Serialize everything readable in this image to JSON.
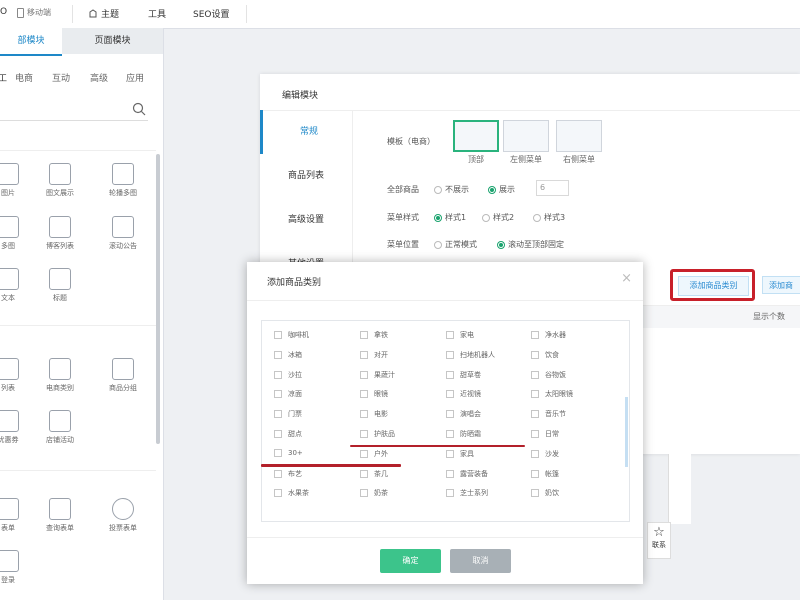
{
  "topbar": {
    "device": "移动端",
    "theme": "主题",
    "tools": "工具",
    "seo": "SEO设置"
  },
  "sidebar": {
    "tabs": [
      "部模块",
      "页面模块"
    ],
    "categories": [
      "电商",
      "互动",
      "高级",
      "应用"
    ],
    "components": [
      {
        "label": "图片",
        "icon": "image-icon"
      },
      {
        "label": "图文展示",
        "icon": "image-text-icon"
      },
      {
        "label": "轮播多图",
        "icon": "carousel-icon"
      },
      {
        "label": "多图",
        "icon": "multi-image-icon"
      },
      {
        "label": "博客列表",
        "icon": "blog-list-icon"
      },
      {
        "label": "滚动公告",
        "icon": "notice-icon"
      },
      {
        "label": "文本",
        "icon": "text-icon"
      },
      {
        "label": "标题",
        "icon": "title-icon"
      },
      {
        "label": "列表",
        "icon": "list-icon"
      },
      {
        "label": "电商类别",
        "icon": "category-icon"
      },
      {
        "label": "商品分组",
        "icon": "group-icon"
      },
      {
        "label": "优惠券",
        "icon": "coupon-icon"
      },
      {
        "label": "店铺活动",
        "icon": "shop-activity-icon"
      },
      {
        "label": "表单",
        "icon": "form-icon"
      },
      {
        "label": "查询表单",
        "icon": "query-form-icon"
      },
      {
        "label": "投票表单",
        "icon": "vote-form-icon"
      },
      {
        "label": "登录",
        "icon": "login-icon"
      }
    ]
  },
  "editor": {
    "title": "编辑模块",
    "menu": [
      "常规",
      "商品列表",
      "高级设置",
      "其他设置"
    ],
    "template_label": "模板（电商）",
    "templates": [
      "顶部",
      "左侧菜单",
      "右侧菜单"
    ],
    "all_goods_label": "全部商品",
    "all_goods_options": [
      "不展示",
      "展示"
    ],
    "all_goods_count": "6",
    "menu_style_label": "菜单样式",
    "menu_style_options": [
      "样式1",
      "样式2",
      "样式3"
    ],
    "menu_position_label": "菜单位置",
    "menu_position_options": [
      "正常模式",
      "滚动至顶部固定"
    ],
    "add_category_button": "添加商品类别",
    "add_goods_button": "添加商",
    "table_header_count": "显示个数",
    "contact_label": "联系"
  },
  "modal": {
    "title": "添加商品类别",
    "close": "×",
    "categories": [
      "咖啡机",
      "拿铁",
      "家电",
      "净水器",
      "冰箱",
      "对开",
      "扫地机器人",
      "饮食",
      "沙拉",
      "果蔬汁",
      "甜草卷",
      "谷物饭",
      "凉面",
      "眼镜",
      "近视镜",
      "太阳眼镜",
      "门票",
      "电影",
      "演唱会",
      "音乐节",
      "甜点",
      "护肤品",
      "防晒霜",
      "日常",
      "30+",
      "户外",
      "家具",
      "沙发",
      "布艺",
      "茶几",
      "露营装备",
      "帐篷",
      "水果茶",
      "奶茶",
      "芝士系列",
      "奶饮"
    ],
    "confirm": "确定",
    "cancel": "取消"
  },
  "colors": {
    "accent": "#1aa36e",
    "highlight_border": "#c8202a",
    "confirm_button": "#3cc48b",
    "cancel_button": "#a8b0b6",
    "modal_overlay": "#eef0f3"
  }
}
